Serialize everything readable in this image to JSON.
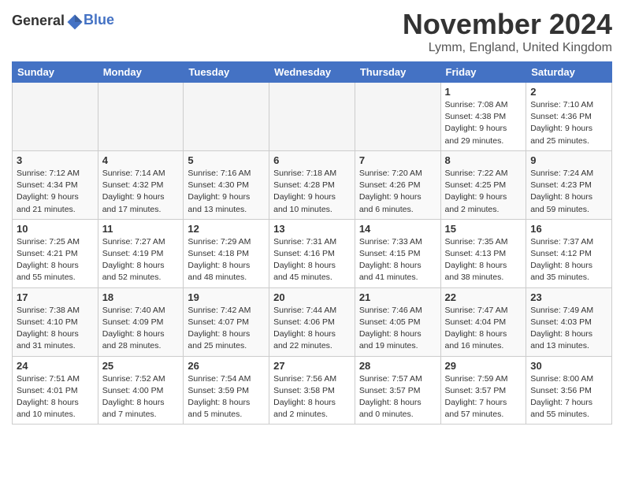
{
  "header": {
    "logo_general": "General",
    "logo_blue": "Blue",
    "month": "November 2024",
    "location": "Lymm, England, United Kingdom"
  },
  "weekdays": [
    "Sunday",
    "Monday",
    "Tuesday",
    "Wednesday",
    "Thursday",
    "Friday",
    "Saturday"
  ],
  "weeks": [
    [
      {
        "day": "",
        "info": ""
      },
      {
        "day": "",
        "info": ""
      },
      {
        "day": "",
        "info": ""
      },
      {
        "day": "",
        "info": ""
      },
      {
        "day": "",
        "info": ""
      },
      {
        "day": "1",
        "info": "Sunrise: 7:08 AM\nSunset: 4:38 PM\nDaylight: 9 hours\nand 29 minutes."
      },
      {
        "day": "2",
        "info": "Sunrise: 7:10 AM\nSunset: 4:36 PM\nDaylight: 9 hours\nand 25 minutes."
      }
    ],
    [
      {
        "day": "3",
        "info": "Sunrise: 7:12 AM\nSunset: 4:34 PM\nDaylight: 9 hours\nand 21 minutes."
      },
      {
        "day": "4",
        "info": "Sunrise: 7:14 AM\nSunset: 4:32 PM\nDaylight: 9 hours\nand 17 minutes."
      },
      {
        "day": "5",
        "info": "Sunrise: 7:16 AM\nSunset: 4:30 PM\nDaylight: 9 hours\nand 13 minutes."
      },
      {
        "day": "6",
        "info": "Sunrise: 7:18 AM\nSunset: 4:28 PM\nDaylight: 9 hours\nand 10 minutes."
      },
      {
        "day": "7",
        "info": "Sunrise: 7:20 AM\nSunset: 4:26 PM\nDaylight: 9 hours\nand 6 minutes."
      },
      {
        "day": "8",
        "info": "Sunrise: 7:22 AM\nSunset: 4:25 PM\nDaylight: 9 hours\nand 2 minutes."
      },
      {
        "day": "9",
        "info": "Sunrise: 7:24 AM\nSunset: 4:23 PM\nDaylight: 8 hours\nand 59 minutes."
      }
    ],
    [
      {
        "day": "10",
        "info": "Sunrise: 7:25 AM\nSunset: 4:21 PM\nDaylight: 8 hours\nand 55 minutes."
      },
      {
        "day": "11",
        "info": "Sunrise: 7:27 AM\nSunset: 4:19 PM\nDaylight: 8 hours\nand 52 minutes."
      },
      {
        "day": "12",
        "info": "Sunrise: 7:29 AM\nSunset: 4:18 PM\nDaylight: 8 hours\nand 48 minutes."
      },
      {
        "day": "13",
        "info": "Sunrise: 7:31 AM\nSunset: 4:16 PM\nDaylight: 8 hours\nand 45 minutes."
      },
      {
        "day": "14",
        "info": "Sunrise: 7:33 AM\nSunset: 4:15 PM\nDaylight: 8 hours\nand 41 minutes."
      },
      {
        "day": "15",
        "info": "Sunrise: 7:35 AM\nSunset: 4:13 PM\nDaylight: 8 hours\nand 38 minutes."
      },
      {
        "day": "16",
        "info": "Sunrise: 7:37 AM\nSunset: 4:12 PM\nDaylight: 8 hours\nand 35 minutes."
      }
    ],
    [
      {
        "day": "17",
        "info": "Sunrise: 7:38 AM\nSunset: 4:10 PM\nDaylight: 8 hours\nand 31 minutes."
      },
      {
        "day": "18",
        "info": "Sunrise: 7:40 AM\nSunset: 4:09 PM\nDaylight: 8 hours\nand 28 minutes."
      },
      {
        "day": "19",
        "info": "Sunrise: 7:42 AM\nSunset: 4:07 PM\nDaylight: 8 hours\nand 25 minutes."
      },
      {
        "day": "20",
        "info": "Sunrise: 7:44 AM\nSunset: 4:06 PM\nDaylight: 8 hours\nand 22 minutes."
      },
      {
        "day": "21",
        "info": "Sunrise: 7:46 AM\nSunset: 4:05 PM\nDaylight: 8 hours\nand 19 minutes."
      },
      {
        "day": "22",
        "info": "Sunrise: 7:47 AM\nSunset: 4:04 PM\nDaylight: 8 hours\nand 16 minutes."
      },
      {
        "day": "23",
        "info": "Sunrise: 7:49 AM\nSunset: 4:03 PM\nDaylight: 8 hours\nand 13 minutes."
      }
    ],
    [
      {
        "day": "24",
        "info": "Sunrise: 7:51 AM\nSunset: 4:01 PM\nDaylight: 8 hours\nand 10 minutes."
      },
      {
        "day": "25",
        "info": "Sunrise: 7:52 AM\nSunset: 4:00 PM\nDaylight: 8 hours\nand 7 minutes."
      },
      {
        "day": "26",
        "info": "Sunrise: 7:54 AM\nSunset: 3:59 PM\nDaylight: 8 hours\nand 5 minutes."
      },
      {
        "day": "27",
        "info": "Sunrise: 7:56 AM\nSunset: 3:58 PM\nDaylight: 8 hours\nand 2 minutes."
      },
      {
        "day": "28",
        "info": "Sunrise: 7:57 AM\nSunset: 3:57 PM\nDaylight: 8 hours\nand 0 minutes."
      },
      {
        "day": "29",
        "info": "Sunrise: 7:59 AM\nSunset: 3:57 PM\nDaylight: 7 hours\nand 57 minutes."
      },
      {
        "day": "30",
        "info": "Sunrise: 8:00 AM\nSunset: 3:56 PM\nDaylight: 7 hours\nand 55 minutes."
      }
    ]
  ]
}
